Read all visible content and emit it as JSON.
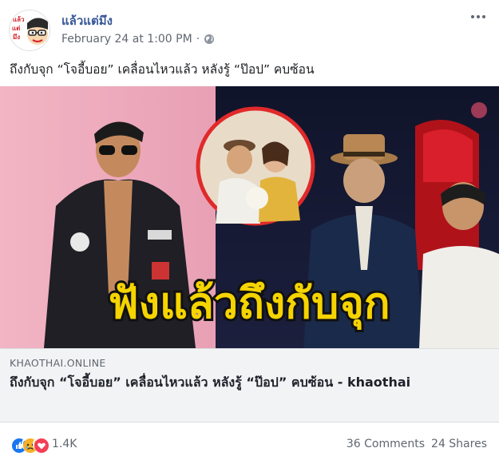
{
  "post": {
    "page_name": "แล้วแต่มึง",
    "timestamp": "February 24 at 1:00 PM",
    "separator": "·",
    "privacy_icon": "globe-icon",
    "more_icon": "more-options-icon",
    "caption": "ถึงกับจุก “โจอี้บอย” เคลื่อนไหวแล้ว หลังรู้ “ป๊อป” คบซ้อน"
  },
  "avatar": {
    "lettering": [
      "แล้ว",
      "แต่",
      "มึง"
    ]
  },
  "link_card": {
    "image_overlay_text": "ฟังแล้วถึงกับจุก",
    "domain": "KHAOTHAI.ONLINE",
    "title": "ถึงกับจุก “โจอี้บอย” เคลื่อนไหวแล้ว หลังรู้ “ป๊อป” คบซ้อน - khaothai"
  },
  "footer": {
    "reaction_icons": [
      "like-icon",
      "sad-icon",
      "love-icon"
    ],
    "reaction_count": "1.4K",
    "comments": "36 Comments",
    "shares": "24 Shares"
  },
  "colors": {
    "link_blue": "#385898",
    "meta_gray": "#606770",
    "overlay_text": "#f5d400",
    "like_blue": "#1877f2",
    "love_red": "#f33e58",
    "sad_yellow": "#f7b125"
  }
}
